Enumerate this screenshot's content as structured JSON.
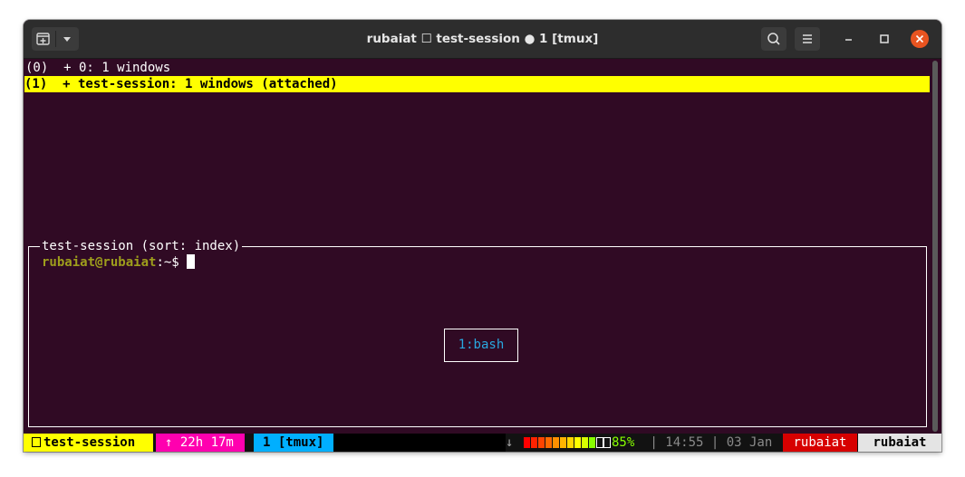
{
  "window": {
    "title": "rubaiat ☐ test-session ● 1 [tmux]"
  },
  "titlebar_icons": {
    "new_tab": "new-tab-icon",
    "dropdown": "chevron-down-icon",
    "search": "search-icon",
    "menu": "hamburger-menu-icon",
    "minimize": "minimize-icon",
    "maximize": "maximize-icon",
    "close": "close-icon"
  },
  "tree": {
    "rows": [
      {
        "text": "(0)  + 0: 1 windows"
      },
      {
        "text": "(1)  + test-session: 1 windows (attached)"
      }
    ]
  },
  "preview": {
    "title": "test-session (sort: index)",
    "prompt_user": "rubaiat@rubaiat",
    "prompt_rest": ":~$ ",
    "pane_label": "1:bash"
  },
  "status": {
    "session": "test-session",
    "uptime": "↑ 22h 17m",
    "window": "1 [tmux]",
    "down_arrow": "↓",
    "battery_percent": "85%",
    "time_date": " | 14:55 | 03 Jan",
    "user1": "rubaiat",
    "user2": "rubaiat"
  },
  "colors": {
    "terminal_bg": "#300a24",
    "highlight": "#ffff00",
    "pane_label": "#29a8e0",
    "close_button": "#e95420",
    "status_uptime": "#ff00af",
    "status_window": "#00afff",
    "status_user1": "#d70000",
    "battery_pct": "#87ff00"
  }
}
